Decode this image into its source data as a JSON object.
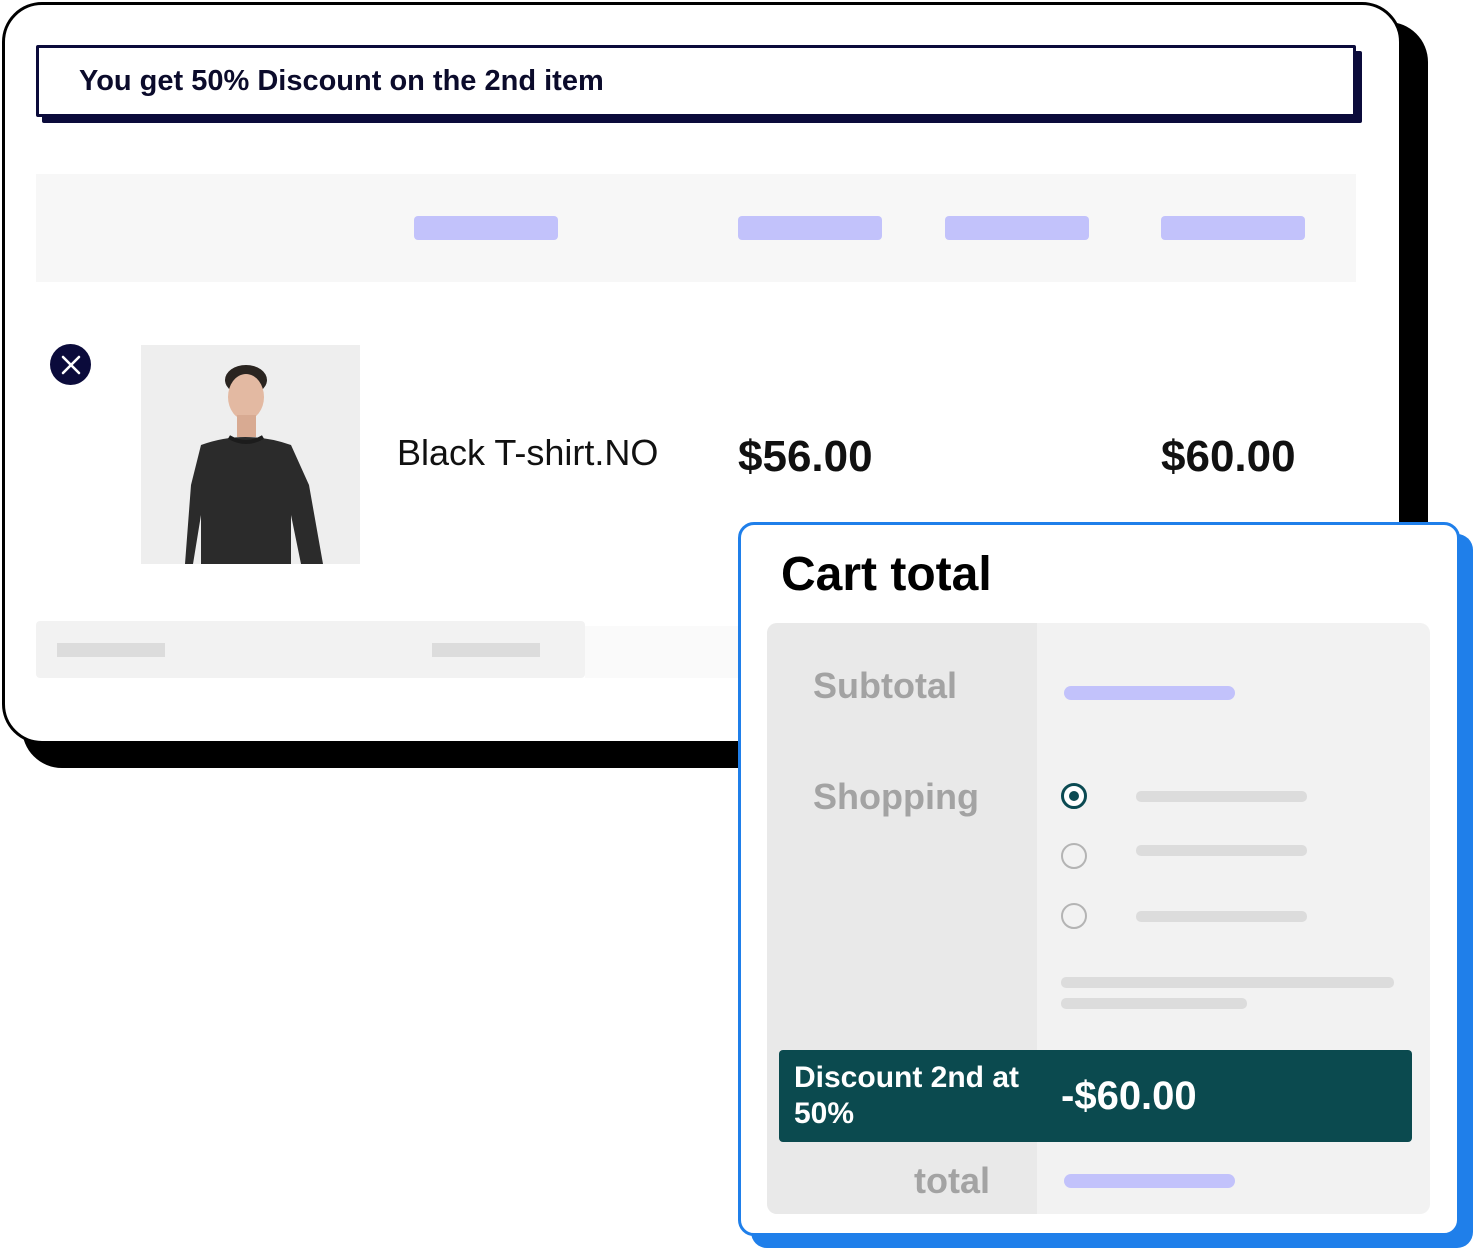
{
  "promo": {
    "text": "You get 50% Discount on the 2nd item"
  },
  "cart_item": {
    "product_name": "Black T-shirt.NO",
    "price": "$56.00",
    "total": "$60.00",
    "remove_icon": "close-icon"
  },
  "cart_total": {
    "title": "Cart total",
    "subtotal_label": "Subtotal",
    "shipping_label": "Shopping",
    "shipping_options_count": 3,
    "selected_option_index": 0,
    "discount_label": "Discount 2nd at 50%",
    "discount_value": "-$60.00",
    "total_label": "total"
  },
  "colors": {
    "accent_blue": "#1f7fea",
    "navy": "#0b0b3b",
    "teal": "#0b4a4f",
    "placeholder_lavender": "#c2c2fb"
  }
}
